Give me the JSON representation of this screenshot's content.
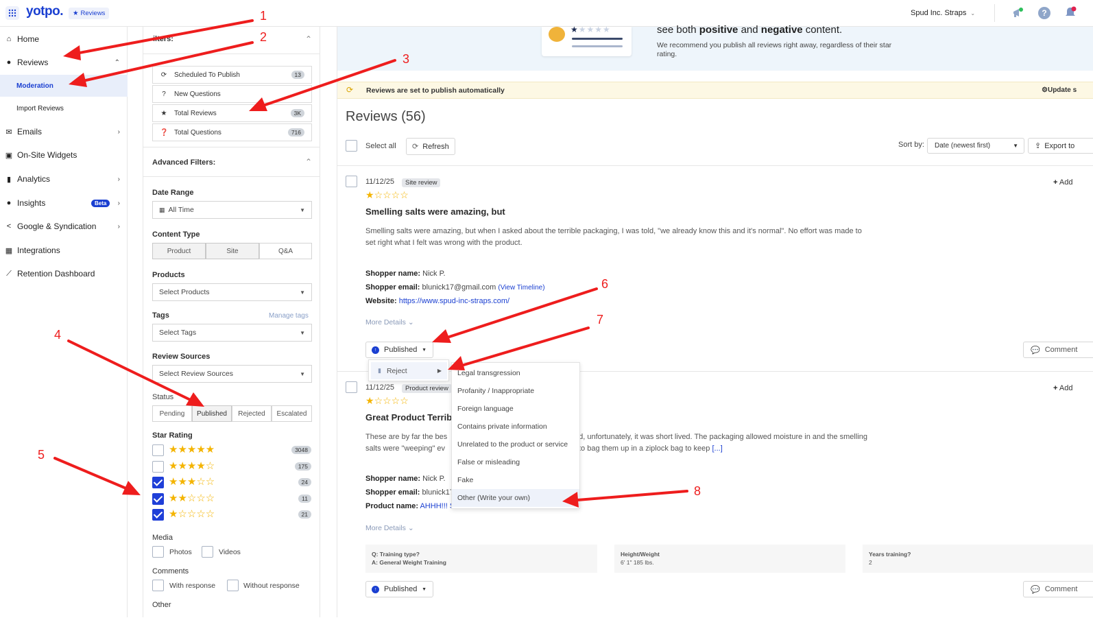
{
  "topbar": {
    "brand": "yotpo.",
    "product_badge": "Reviews",
    "account": "Spud Inc. Straps"
  },
  "sidebar": {
    "items": [
      {
        "label": "Home",
        "icon": "home-icon"
      },
      {
        "label": "Reviews",
        "icon": "reviews-icon"
      },
      {
        "label": "Moderation"
      },
      {
        "label": "Import Reviews"
      },
      {
        "label": "Emails",
        "icon": "mail-icon"
      },
      {
        "label": "On-Site Widgets",
        "icon": "widgets-icon"
      },
      {
        "label": "Analytics",
        "icon": "analytics-icon"
      },
      {
        "label": "Insights",
        "icon": "bulb-icon",
        "badge": "Beta"
      },
      {
        "label": "Google & Syndication",
        "icon": "share-icon"
      },
      {
        "label": "Integrations",
        "icon": "integrations-icon"
      },
      {
        "label": "Retention Dashboard",
        "icon": "chart-icon"
      }
    ]
  },
  "filters": {
    "header": "ilters:",
    "quick": [
      {
        "label": "Scheduled To Publish",
        "count": "13"
      },
      {
        "label": "New Questions",
        "count": ""
      },
      {
        "label": "Total Reviews",
        "count": "3K"
      },
      {
        "label": "Total Questions",
        "count": "716"
      }
    ],
    "advanced_title": "Advanced Filters:",
    "date_range_label": "Date Range",
    "date_range_value": "All Time",
    "content_type_label": "Content Type",
    "content_types": [
      "Product",
      "Site",
      "Q&A"
    ],
    "products_label": "Products",
    "products_placeholder": "Select Products",
    "tags_label": "Tags",
    "manage_tags": "Manage tags",
    "tags_placeholder": "Select Tags",
    "review_sources_label": "Review Sources",
    "review_sources_placeholder": "Select Review Sources",
    "status_label": "Status",
    "statuses": [
      "Pending",
      "Published",
      "Rejected",
      "Escalated"
    ],
    "star_rating_label": "Star Rating",
    "star_ratings": [
      {
        "stars": 5,
        "count": "3048",
        "checked": false
      },
      {
        "stars": 4,
        "count": "175",
        "checked": false
      },
      {
        "stars": 3,
        "count": "24",
        "checked": true
      },
      {
        "stars": 2,
        "count": "11",
        "checked": true
      },
      {
        "stars": 1,
        "count": "21",
        "checked": true
      }
    ],
    "media_label": "Media",
    "media_options": [
      "Photos",
      "Videos"
    ],
    "comments_label": "Comments",
    "comments_options": [
      "With response",
      "Without response"
    ],
    "other_label": "Other"
  },
  "banner": {
    "headline_pre": "see both ",
    "headline_b1": "positive",
    "headline_mid": " and ",
    "headline_b2": "negative",
    "headline_post": " content.",
    "body": "We recommend you publish all reviews right away, regardless of their star rating."
  },
  "notice": {
    "text": "Reviews are set to publish automatically",
    "action": "Update s"
  },
  "reviews_header": {
    "title": "Reviews (56)",
    "select_all": "Select all",
    "refresh": "Refresh",
    "sort_label": "Sort by:",
    "sort_value": "Date (newest first)",
    "export": "Export to"
  },
  "reviews": [
    {
      "date": "11/12/25",
      "type": "Site review",
      "rating": 1,
      "title": "Smelling salts were amazing, but",
      "body_line1": "Smelling salts were amazing, but when I asked about the terrible packaging, I was told, \"we already know this and it's normal\". No effort was made to",
      "body_line2": "set right what I felt was wrong with the product.",
      "shopper_name_label": "Shopper name:",
      "shopper_name": "Nick P.",
      "shopper_email_label": "Shopper email:",
      "shopper_email": "blunick17@gmail.com",
      "view_timeline": "(View Timeline)",
      "website_label": "Website:",
      "website": "https://www.spud-inc-straps.com/",
      "more_details": "More Details",
      "status": "Published",
      "add": "Add",
      "comment": "Comment"
    },
    {
      "date": "11/12/25",
      "type": "Product review",
      "rating": 1,
      "title": "Great Product Terrib",
      "body_line1a": "These are by far the bes",
      "body_line1b": "ed, unfortunately, it was short lived. The packaging allowed moisture in and the smelling",
      "body_line2a": "salts were \"weeping\" ev",
      "body_line2b": "to bag them up in a ziplock bag to keep",
      "read_more": "[...]",
      "shopper_name_label": "Shopper name:",
      "shopper_name": "Nick P.",
      "shopper_email_label": "Shopper email:",
      "shopper_email": "blunick17",
      "product_label": "Product name:",
      "product": "AHHH!!! S",
      "more_details": "More Details",
      "qa": [
        {
          "q": "Q: Training type?",
          "a": "A: General Weight Training"
        },
        {
          "q": "Height/Weight",
          "a": "6' 1\" 185 lbs."
        },
        {
          "q": "Years training?",
          "a": "2"
        }
      ],
      "status": "Published",
      "add": "Add",
      "comment": "Comment"
    }
  ],
  "status_menu": {
    "reject": "Reject",
    "reasons": [
      "Legal transgression",
      "Profanity / Inappropriate",
      "Foreign language",
      "Contains private information",
      "Unrelated to the product or service",
      "False or misleading",
      "Fake",
      "Other (Write your own)"
    ]
  },
  "annotations": [
    "1",
    "2",
    "3",
    "4",
    "5",
    "6",
    "7",
    "8"
  ],
  "colors": {
    "brand": "#1a3fd1",
    "annotation": "#ee1d1d",
    "star": "#f4b400",
    "notice_bg": "#fdf8e4",
    "banner_bg": "#eef5fb",
    "active_nav_bg": "#e8eefa"
  }
}
